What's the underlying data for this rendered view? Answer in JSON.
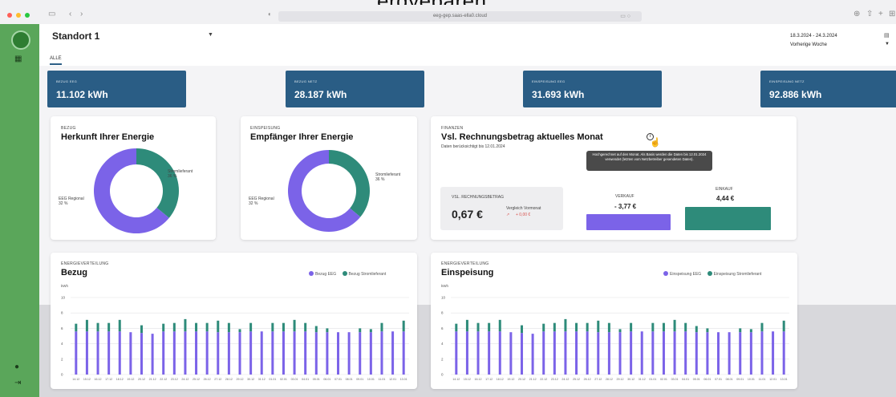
{
  "overlay_text": "ergyeparen",
  "browser": {
    "url": "eeg-gep.saas-ella0.cloud"
  },
  "header": {
    "location": "Standort 1",
    "tab_all": "ALLE",
    "date_range": "18.3.2024 - 24.3.2024",
    "period": "Vorherige Woche"
  },
  "kpis": [
    {
      "label": "BEZUG EEG",
      "value": "11.102 kWh"
    },
    {
      "label": "BEZUG NETZ",
      "value": "28.187 kWh"
    },
    {
      "label": "EINSPEISUNG EEG",
      "value": "31.693 kWh"
    },
    {
      "label": "EINSPEISUNG NETZ",
      "value": "92.886 kWh"
    }
  ],
  "bezug_donut": {
    "overline": "BEZUG",
    "title": "Herkunft Ihrer Energie",
    "segments": [
      {
        "name": "Stromlieferant",
        "value": 36,
        "label": "Stromlieferant\n36 %",
        "color": "#2e8b7a"
      },
      {
        "name": "EEG Regional",
        "value": 64,
        "label": "EEG Regional\n32 %",
        "color": "#7b63e8"
      }
    ]
  },
  "einspeisung_donut": {
    "overline": "EINSPEISUNG",
    "title": "Empfänger Ihrer Energie",
    "segments": [
      {
        "name": "Stromlieferant",
        "value": 36,
        "label": "Stromlieferant\n36 %",
        "color": "#2e8b7a"
      },
      {
        "name": "EEG Regional",
        "value": 64,
        "label": "EEG Regional\n32 %",
        "color": "#7b63e8"
      }
    ]
  },
  "finanzen": {
    "overline": "FINANZEN",
    "title": "Vsl. Rechnungsbetrag aktuelles Monat",
    "note": "Daten berücksichtigt bis 12.01.2024",
    "tooltip": "Hochgerechnet auf den Monat. Als Basis werden die Daten bis 12.01.2024 verwendet (letzten vom Netzbetreiber gesendeten Daten).",
    "box_label": "VSL. RECHNUNGSBETRAG",
    "box_value": "0,67 €",
    "compare_label": "Vergleich Vormonat",
    "compare_value": "+ 0,00 €",
    "verkauf_label": "VERKAUF",
    "verkauf_value": "- 3,77 €",
    "einkauf_label": "EINKAUF",
    "einkauf_value": "4,44 €",
    "colors": {
      "verkauf": "#7b63e8",
      "einkauf": "#2e8b7a",
      "compare": "#d9534f"
    }
  },
  "chart_bezug": {
    "overline": "ENERGIEVERTEILUNG",
    "title": "Bezug",
    "legend": [
      "Bezug EEG",
      "Bezug Stromlieferant"
    ]
  },
  "chart_einspeisung": {
    "overline": "ENERGIEVERTEILUNG",
    "title": "Einspeisung",
    "legend": [
      "Einspeisung EEG",
      "Einspeisung Stromlieferant"
    ]
  },
  "chart_data": [
    {
      "type": "bar",
      "title": "Bezug",
      "ylabel": "kWh",
      "ylim": [
        0,
        10
      ],
      "yticks": [
        0,
        2,
        4,
        6,
        8,
        10
      ],
      "categories": [
        "14.12",
        "15.12",
        "16.12",
        "17.12",
        "18.12",
        "19.12",
        "20.12",
        "21.12",
        "22.12",
        "23.12",
        "24.12",
        "25.12",
        "26.12",
        "27.12",
        "28.12",
        "29.12",
        "30.12",
        "31.12",
        "01.01",
        "02.01",
        "03.01",
        "04.01",
        "05.01",
        "06.01",
        "07.01",
        "08.01",
        "09.01",
        "10.01",
        "11.01",
        "12.01",
        "13.01"
      ],
      "series": [
        {
          "name": "Bezug EEG",
          "color": "#7b63e8",
          "values": [
            5.6,
            5.6,
            5.6,
            5.6,
            5.6,
            5.5,
            5.4,
            5.3,
            5.6,
            5.6,
            5.6,
            5.6,
            5.6,
            5.5,
            5.5,
            5.5,
            5.6,
            5.6,
            5.6,
            5.6,
            5.6,
            5.6,
            5.5,
            5.5,
            5.5,
            5.5,
            5.5,
            5.5,
            5.6,
            5.6,
            5.6
          ]
        },
        {
          "name": "Bezug Stromlieferant",
          "color": "#2e8b7a",
          "values": [
            1.0,
            1.5,
            1.1,
            1.1,
            1.5,
            0.0,
            1.0,
            0.0,
            1.0,
            1.1,
            1.6,
            1.1,
            1.1,
            1.5,
            1.2,
            0.4,
            1.1,
            0.0,
            1.1,
            1.1,
            1.5,
            1.1,
            0.8,
            0.5,
            0.0,
            0.0,
            0.5,
            0.4,
            1.1,
            0.0,
            1.4
          ]
        }
      ]
    },
    {
      "type": "bar",
      "title": "Einspeisung",
      "ylabel": "kWh",
      "ylim": [
        0,
        10
      ],
      "yticks": [
        0,
        2,
        4,
        6,
        8,
        10
      ],
      "categories": [
        "14.12",
        "15.12",
        "16.12",
        "17.12",
        "18.12",
        "19.12",
        "20.12",
        "21.12",
        "22.12",
        "23.12",
        "24.12",
        "25.12",
        "26.12",
        "27.12",
        "28.12",
        "29.12",
        "30.12",
        "31.12",
        "01.01",
        "02.01",
        "03.01",
        "04.01",
        "05.01",
        "06.01",
        "07.01",
        "08.01",
        "09.01",
        "10.01",
        "11.01",
        "12.01",
        "13.01"
      ],
      "series": [
        {
          "name": "Einspeisung EEG",
          "color": "#7b63e8",
          "values": [
            5.6,
            5.6,
            5.6,
            5.6,
            5.6,
            5.5,
            5.4,
            5.3,
            5.6,
            5.6,
            5.6,
            5.6,
            5.6,
            5.5,
            5.5,
            5.5,
            5.6,
            5.6,
            5.6,
            5.6,
            5.6,
            5.6,
            5.5,
            5.5,
            5.5,
            5.5,
            5.5,
            5.5,
            5.6,
            5.6,
            5.6
          ]
        },
        {
          "name": "Einspeisung Stromlieferant",
          "color": "#2e8b7a",
          "values": [
            1.0,
            1.5,
            1.1,
            1.1,
            1.5,
            0.0,
            1.0,
            0.0,
            1.0,
            1.1,
            1.6,
            1.1,
            1.1,
            1.5,
            1.2,
            0.4,
            1.1,
            0.0,
            1.1,
            1.1,
            1.5,
            1.1,
            0.8,
            0.5,
            0.0,
            0.0,
            0.5,
            0.4,
            1.1,
            0.0,
            1.4
          ]
        }
      ]
    }
  ]
}
